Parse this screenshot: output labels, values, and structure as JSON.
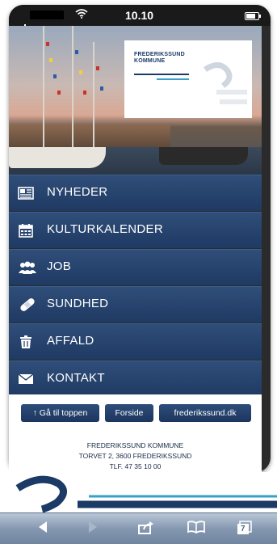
{
  "statusbar": {
    "time": "10.10"
  },
  "hero": {
    "logo_line1": "FREDERIKSSUND",
    "logo_line2": "KOMMUNE"
  },
  "menu": {
    "items": [
      {
        "label": "NYHEDER",
        "icon": "newspaper-icon"
      },
      {
        "label": "KULTURKALENDER",
        "icon": "calendar-icon"
      },
      {
        "label": "JOB",
        "icon": "people-icon"
      },
      {
        "label": "SUNDHED",
        "icon": "bandage-icon"
      },
      {
        "label": "AFFALD",
        "icon": "trash-icon"
      },
      {
        "label": "KONTAKT",
        "icon": "envelope-icon"
      }
    ]
  },
  "footer": {
    "buttons": {
      "top": "↑ Gå til toppen",
      "home": "Forside",
      "site": "frederikssund.dk"
    },
    "address_line1": "FREDERIKSSUND KOMMUNE",
    "address_line2": "TORVET 2, 3600 FREDERIKSSUND",
    "address_line3": "TLF. 47 35 10 00"
  },
  "toolbar": {
    "tabs_count": "7"
  },
  "colors": {
    "menu_bg": "#1f3a63",
    "brand_blue": "#1b3a66",
    "accent_cyan": "#3aa0c8",
    "toolbar": "#8598b1"
  }
}
